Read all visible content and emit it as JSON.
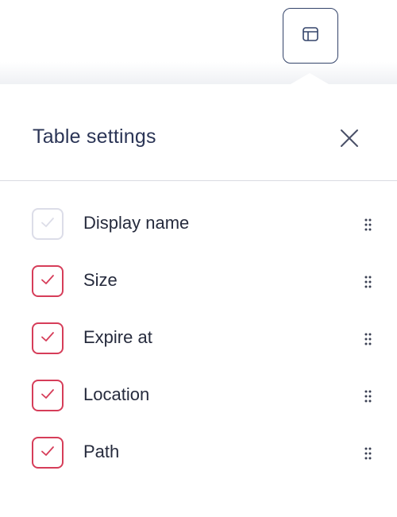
{
  "header": {
    "trigger_icon": "table-layout-icon"
  },
  "popover": {
    "title": "Table settings",
    "close_icon": "close-icon",
    "columns": [
      {
        "label": "Display name",
        "checked": true,
        "disabled": true
      },
      {
        "label": "Size",
        "checked": true,
        "disabled": false
      },
      {
        "label": "Expire at",
        "checked": true,
        "disabled": false
      },
      {
        "label": "Location",
        "checked": true,
        "disabled": false
      },
      {
        "label": "Path",
        "checked": true,
        "disabled": false
      }
    ],
    "drag_icon": "drag-handle-icon"
  },
  "colors": {
    "accent": "#d63d59",
    "disabled_border": "#dcdde8",
    "title": "#2b3556",
    "trigger_border": "#34446a"
  }
}
